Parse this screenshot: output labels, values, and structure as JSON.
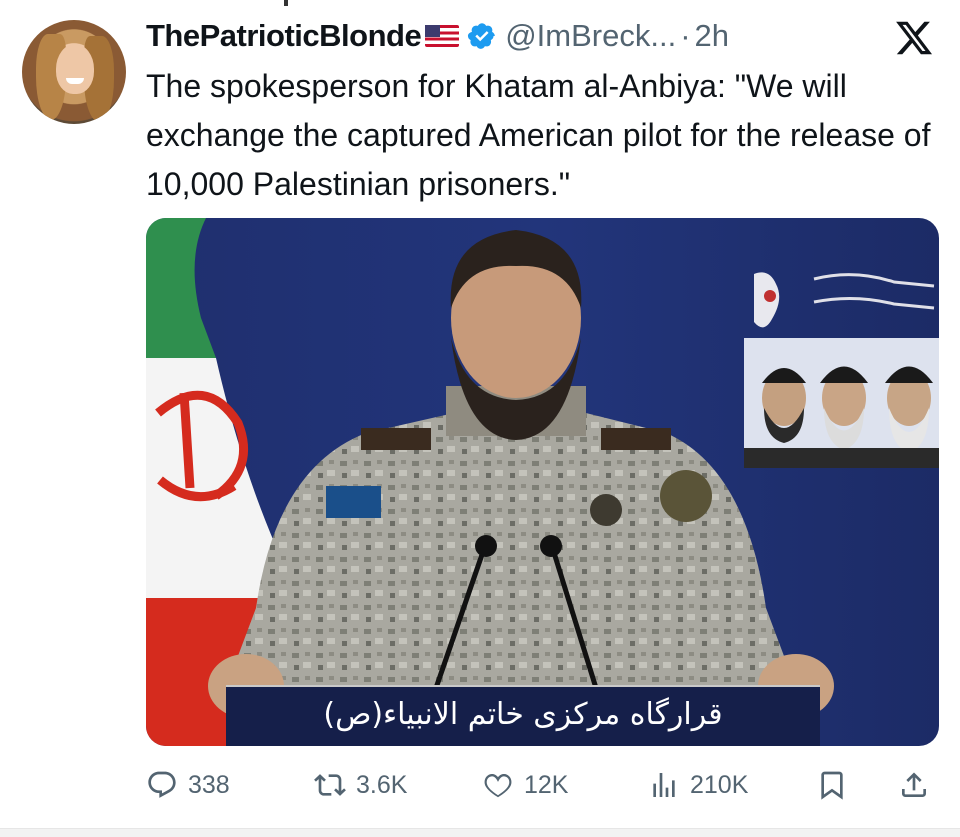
{
  "tweet": {
    "display_name": "ThePatrioticBlonde",
    "handle": "@ImBreck...",
    "separator": "·",
    "time": "2h",
    "text": "The spokesperson for Khatam al-Anbiya: \"We will exchange the captured American pilot for the release of 10,000 Palestinian prisoners.\"",
    "badges": {
      "flag_icon": "us-flag-icon",
      "verified_icon": "verified-badge-icon"
    }
  },
  "media": {
    "podium_caption": "قرارگاه مرکزی خاتم الانبیاء(ص)"
  },
  "actions": {
    "replies": "338",
    "reposts": "3.6K",
    "likes": "12K",
    "views": "210K"
  },
  "colors": {
    "text": "#0f1419",
    "muted": "#536471",
    "verified": "#1d9bf0",
    "media_bg": "#22357b"
  }
}
